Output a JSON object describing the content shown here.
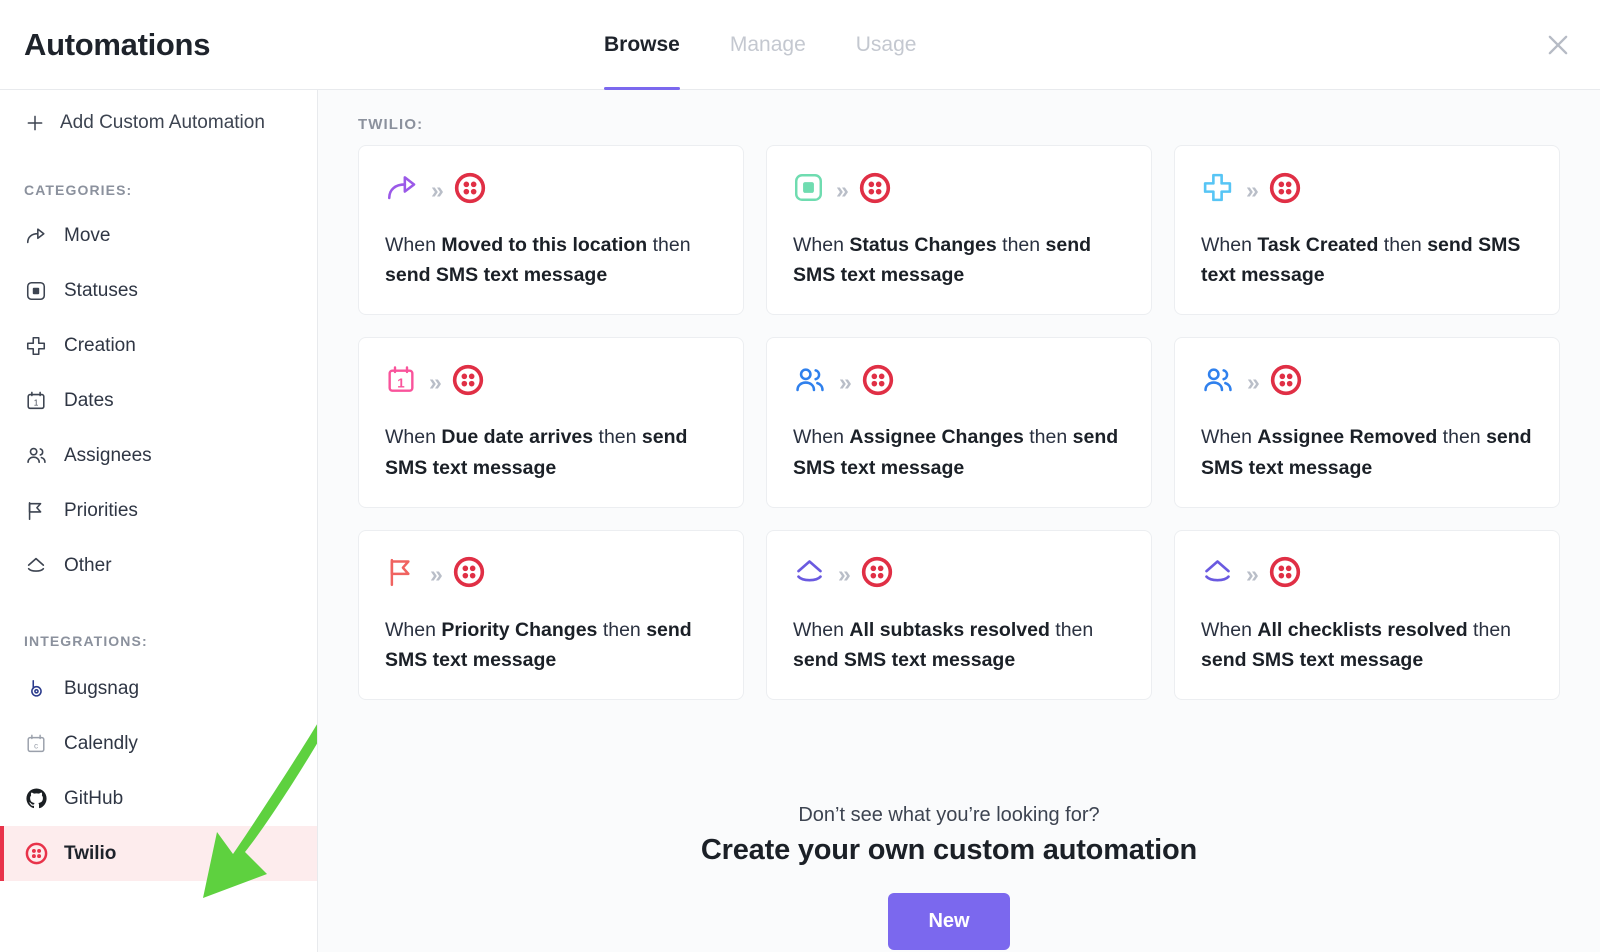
{
  "header": {
    "title": "Automations",
    "close_icon": "close-icon",
    "tabs": [
      {
        "label": "Browse",
        "active": true
      },
      {
        "label": "Manage",
        "active": false
      },
      {
        "label": "Usage",
        "active": false
      }
    ]
  },
  "sidebar": {
    "add_custom": {
      "label": "Add Custom Automation",
      "icon": "plus-icon"
    },
    "categories_label": "CATEGORIES:",
    "categories": [
      {
        "label": "Move",
        "icon": "move-arrow-icon"
      },
      {
        "label": "Statuses",
        "icon": "status-square-icon"
      },
      {
        "label": "Creation",
        "icon": "plus-cross-icon"
      },
      {
        "label": "Dates",
        "icon": "calendar-icon"
      },
      {
        "label": "Assignees",
        "icon": "people-icon"
      },
      {
        "label": "Priorities",
        "icon": "flag-icon"
      },
      {
        "label": "Other",
        "icon": "chevrons-icon"
      }
    ],
    "integrations_label": "INTEGRATIONS:",
    "integrations": [
      {
        "label": "Bugsnag",
        "icon": "bugsnag-icon",
        "selected": false
      },
      {
        "label": "Calendly",
        "icon": "calendly-icon",
        "selected": false
      },
      {
        "label": "GitHub",
        "icon": "github-icon",
        "selected": false
      },
      {
        "label": "Twilio",
        "icon": "twilio-icon",
        "selected": true
      }
    ]
  },
  "main": {
    "group_label": "TWILIO:",
    "cards": [
      {
        "when": "When ",
        "trigger": "Moved to this location",
        "then": " then ",
        "action": "send SMS text message",
        "trigger_icon": "move-arrow-icon",
        "arrow_icon": "chevrons-right-icon",
        "action_icon": "twilio-icon"
      },
      {
        "when": "When ",
        "trigger": "Status Changes",
        "then": " then ",
        "action": "send SMS text message",
        "trigger_icon": "status-square-icon",
        "arrow_icon": "chevrons-right-icon",
        "action_icon": "twilio-icon"
      },
      {
        "when": "When ",
        "trigger": "Task Created",
        "then": " then ",
        "action": "send SMS text message",
        "trigger_icon": "plus-cross-icon",
        "arrow_icon": "chevrons-right-icon",
        "action_icon": "twilio-icon"
      },
      {
        "when": "When ",
        "trigger": "Due date arrives",
        "then": " then ",
        "action": "send SMS text message",
        "trigger_icon": "calendar-icon",
        "arrow_icon": "chevrons-right-icon",
        "action_icon": "twilio-icon"
      },
      {
        "when": "When ",
        "trigger": "Assignee Changes",
        "then": " then ",
        "action": "send SMS text message",
        "trigger_icon": "people-icon",
        "arrow_icon": "chevrons-right-icon",
        "action_icon": "twilio-icon"
      },
      {
        "when": "When ",
        "trigger": "Assignee Removed",
        "then": " then ",
        "action": "send SMS text message",
        "trigger_icon": "people-icon",
        "arrow_icon": "chevrons-right-icon",
        "action_icon": "twilio-icon"
      },
      {
        "when": "When ",
        "trigger": "Priority Changes",
        "then": " then ",
        "action": "send SMS text message",
        "trigger_icon": "flag-icon",
        "arrow_icon": "chevrons-right-icon",
        "action_icon": "twilio-icon"
      },
      {
        "when": "When ",
        "trigger": "All subtasks resolved",
        "then": " then ",
        "action": "send SMS text message",
        "trigger_icon": "chevrons-icon",
        "arrow_icon": "chevrons-right-icon",
        "action_icon": "twilio-icon"
      },
      {
        "when": "When ",
        "trigger": "All checklists resolved",
        "then": " then ",
        "action": "send SMS text message",
        "trigger_icon": "chevrons-icon",
        "arrow_icon": "chevrons-right-icon",
        "action_icon": "twilio-icon"
      }
    ],
    "cta": {
      "subtitle": "Don’t see what you’re looking for?",
      "title": "Create your own custom automation",
      "button_label": "New"
    }
  },
  "annotation": {
    "arrow_icon": "green-pointer-arrow",
    "color": "#5ed13f"
  },
  "colors": {
    "accent_purple": "#7b68ee",
    "twilio_red": "#e8334a",
    "selected_row_bg": "#fdeced",
    "annotation_green": "#5ed13f",
    "status_green": "#7bdcb5",
    "creation_blue": "#53c3f1",
    "dates_pink": "#f9539b",
    "assignee_blue": "#2f80ed",
    "priority_salmon": "#f06360",
    "other_purple": "#6a5ae0",
    "move_purple": "#9b59e8"
  }
}
